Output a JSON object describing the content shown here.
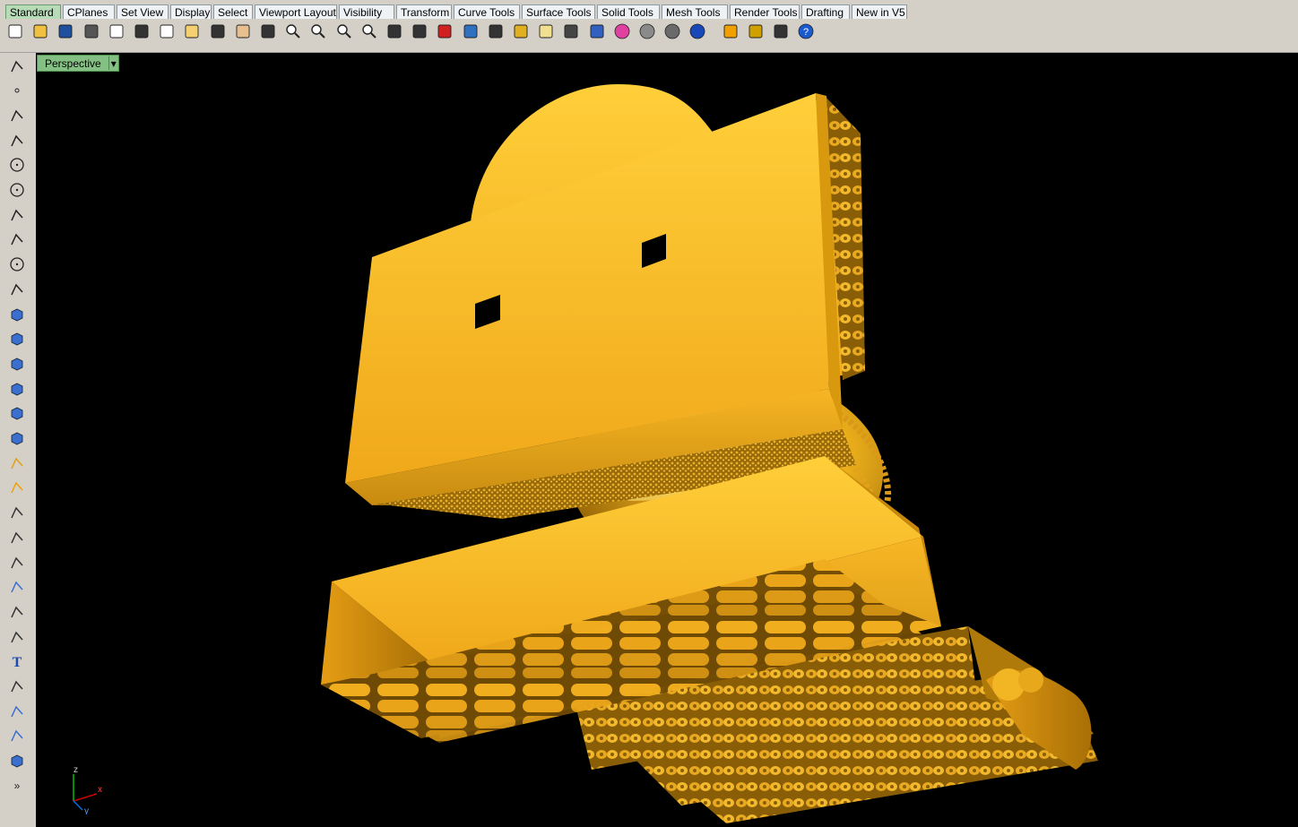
{
  "tabs": [
    {
      "label": "Standard",
      "active": true
    },
    {
      "label": "CPlanes"
    },
    {
      "label": "Set View"
    },
    {
      "label": "Display"
    },
    {
      "label": "Select"
    },
    {
      "label": "Viewport Layout"
    },
    {
      "label": "Visibility"
    },
    {
      "label": "Transform"
    },
    {
      "label": "Curve Tools"
    },
    {
      "label": "Surface Tools"
    },
    {
      "label": "Solid Tools"
    },
    {
      "label": "Mesh Tools"
    },
    {
      "label": "Render Tools"
    },
    {
      "label": "Drafting"
    },
    {
      "label": "New in V5"
    }
  ],
  "toolbar_icons": [
    "new-file-icon",
    "open-folder-icon",
    "save-icon",
    "print-icon",
    "import-icon",
    "cut-icon",
    "copy-icon",
    "paste-icon",
    "undo-icon",
    "pan-hand-icon",
    "rotate-view-icon",
    "zoom-dynamic-icon",
    "zoom-window-icon",
    "zoom-extents-icon",
    "zoom-selected-icon",
    "undo-view-icon",
    "four-viewports-icon",
    "car-icon",
    "cplane-icon",
    "circle-view-icon",
    "osnap-icon",
    "light-bulb-icon",
    "lock-icon",
    "layer-icon",
    "color-wheel-icon",
    "shaded-sphere-icon",
    "rendered-sphere-icon",
    "blue-sphere-icon",
    "gumball-icon",
    "gear-icon",
    "options-icon",
    "help-icon"
  ],
  "left_icons": [
    "select-arrow-icon",
    "point-icon",
    "polyline-icon",
    "curve-icon",
    "circle-icon",
    "ellipse-icon",
    "polygon-icon",
    "rectangle-icon",
    "hexagon-icon",
    "arc-curve-icon",
    "surface-icon",
    "extrude-icon",
    "box-icon",
    "spheres-icon",
    "cylinder-icon",
    "mesh-icon",
    "explode-icon",
    "analyze-icon",
    "split-icon",
    "trim-icon",
    "boolean-icon",
    "group-icon",
    "fillet-icon",
    "offset-icon",
    "text-icon",
    "dimension-icon",
    "array-icon",
    "transform-icon",
    "solid-box-icon",
    "more-icon"
  ],
  "viewport": {
    "label": "Perspective",
    "dropdown": "▾"
  },
  "axes": {
    "z": "z",
    "x": "x",
    "y": "y"
  },
  "colors": {
    "model": "#f5b11a",
    "model_dark": "#b07808",
    "viewport_bg": "#000000",
    "active_tab": "#b5dcb6",
    "view_tab": "#84c084"
  }
}
